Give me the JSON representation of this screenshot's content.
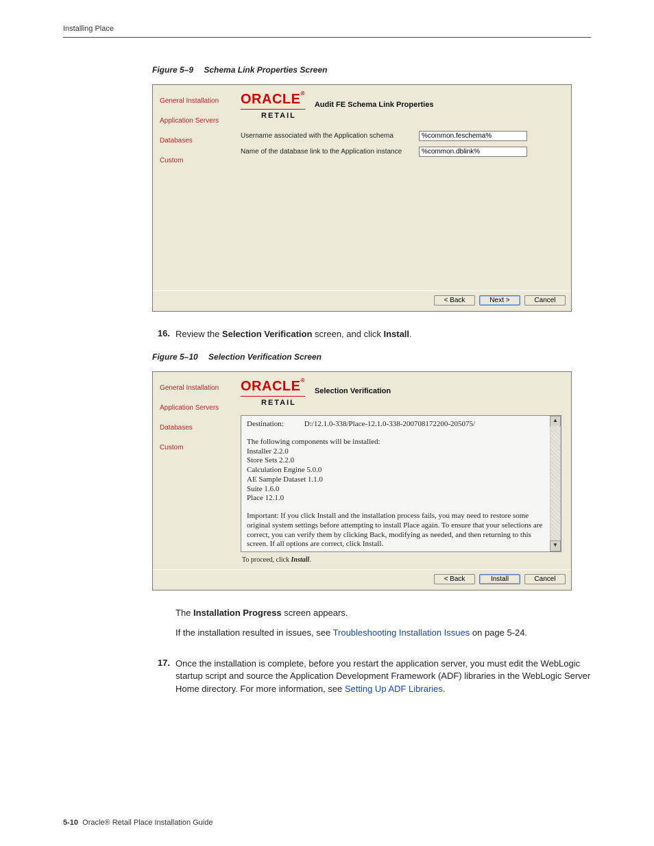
{
  "page": {
    "running_head": "Installing Place",
    "footer_page": "5-10",
    "footer_title": "Oracle® Retail Place Installation Guide"
  },
  "fig9": {
    "label": "Figure 5–9",
    "title": "Schema Link Properties Screen",
    "brand_top": "ORACLE",
    "brand_sub": "RETAIL",
    "installer_title": "Audit FE Schema Link Properties",
    "nav": {
      "general": "General Installation",
      "appservers": "Application Servers",
      "databases": "Databases",
      "custom": "Custom"
    },
    "fields": {
      "username_label": "Username associated with the Application schema",
      "username_value": "%common.feschema%",
      "dblink_label": "Name of the database link to the Application instance",
      "dblink_value": "%common.dblink%"
    },
    "buttons": {
      "back": "< Back",
      "next": "Next >",
      "cancel": "Cancel"
    }
  },
  "step16": {
    "num": "16.",
    "pre": "Review the ",
    "bold1": "Selection Verification",
    "mid": " screen, and click ",
    "bold2": "Install",
    "post": "."
  },
  "fig10": {
    "label": "Figure 5–10",
    "title": "Selection Verification Screen",
    "brand_top": "ORACLE",
    "brand_sub": "RETAIL",
    "installer_title": "Selection Verification",
    "nav": {
      "general": "General Installation",
      "appservers": "Application Servers",
      "databases": "Databases",
      "custom": "Custom"
    },
    "dest_label": "Destination:",
    "dest_value": "D:/12.1.0-338/Place-12.1.0-338-200708172200-205075/",
    "list_intro": "The following components will be installed:",
    "components": [
      "Installer 2.2.0",
      "Store Sets 2.2.0",
      "Calculation Engine 5.0.0",
      "AE Sample Dataset 1.1.0",
      "Suite 1.6.0",
      "Place 12.1.0"
    ],
    "important": "Important: If you click Install and the installation process fails, you may need to restore some original system settings before attempting to install Place again. To ensure that your selections are correct, you can verify them by clicking Back, modifying as needed, and then returning to this screen. If all options are correct, click Install.",
    "proceed": "To proceed, click Install.",
    "buttons": {
      "back": "< Back",
      "install": "Install",
      "cancel": "Cancel"
    }
  },
  "after_fig10": {
    "p1_pre": "The ",
    "p1_bold": "Installation Progress",
    "p1_post": " screen appears.",
    "p2_pre": "If the installation resulted in issues, see ",
    "p2_link": "Troubleshooting Installation Issues",
    "p2_post": " on page 5-24."
  },
  "step17": {
    "num": "17.",
    "text_pre": "Once the installation is complete, before you restart the application server, you must edit the WebLogic startup script and source the Application Development Framework (ADF) libraries in the WebLogic Server Home directory. For more information, see ",
    "link": "Setting Up ADF Libraries",
    "text_post": "."
  }
}
